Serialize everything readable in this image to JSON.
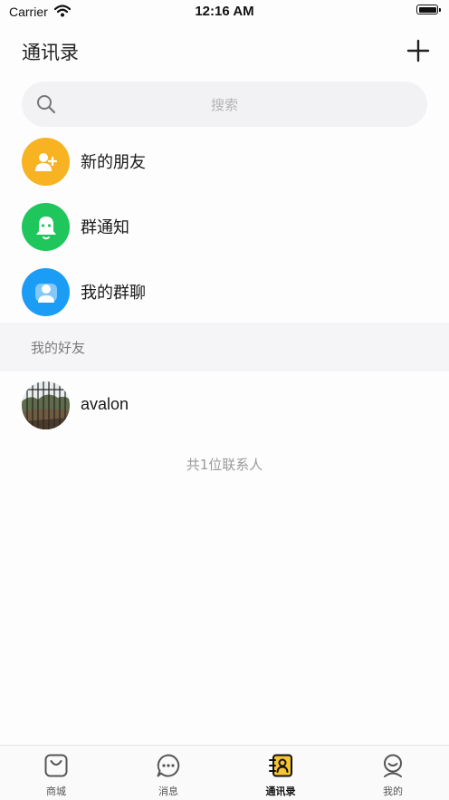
{
  "status_bar": {
    "carrier": "Carrier",
    "time": "12:16 AM"
  },
  "header": {
    "title": "通讯录",
    "add_icon": "plus-icon"
  },
  "search": {
    "placeholder": "搜索",
    "icon": "search-icon"
  },
  "menu": [
    {
      "label": "新的朋友",
      "icon": "add-user-icon",
      "color": "#f7b322"
    },
    {
      "label": "群通知",
      "icon": "bell-icon",
      "color": "#1fc65c"
    },
    {
      "label": "我的群聊",
      "icon": "group-icon",
      "color": "#1b9cf5"
    }
  ],
  "section": {
    "label": "我的好友"
  },
  "friends": [
    {
      "name": "avalon"
    }
  ],
  "contact_count": "共1位联系人",
  "tabs": [
    {
      "label": "商城",
      "icon": "shopping-bag-icon",
      "active": false
    },
    {
      "label": "消息",
      "icon": "chat-bubble-icon",
      "active": false
    },
    {
      "label": "通讯录",
      "icon": "contacts-book-icon",
      "active": true
    },
    {
      "label": "我的",
      "icon": "profile-icon",
      "active": false
    }
  ],
  "colors": {
    "accent": "#f7c432",
    "section_bg": "#f5f5f7",
    "search_bg": "#f2f2f4"
  }
}
